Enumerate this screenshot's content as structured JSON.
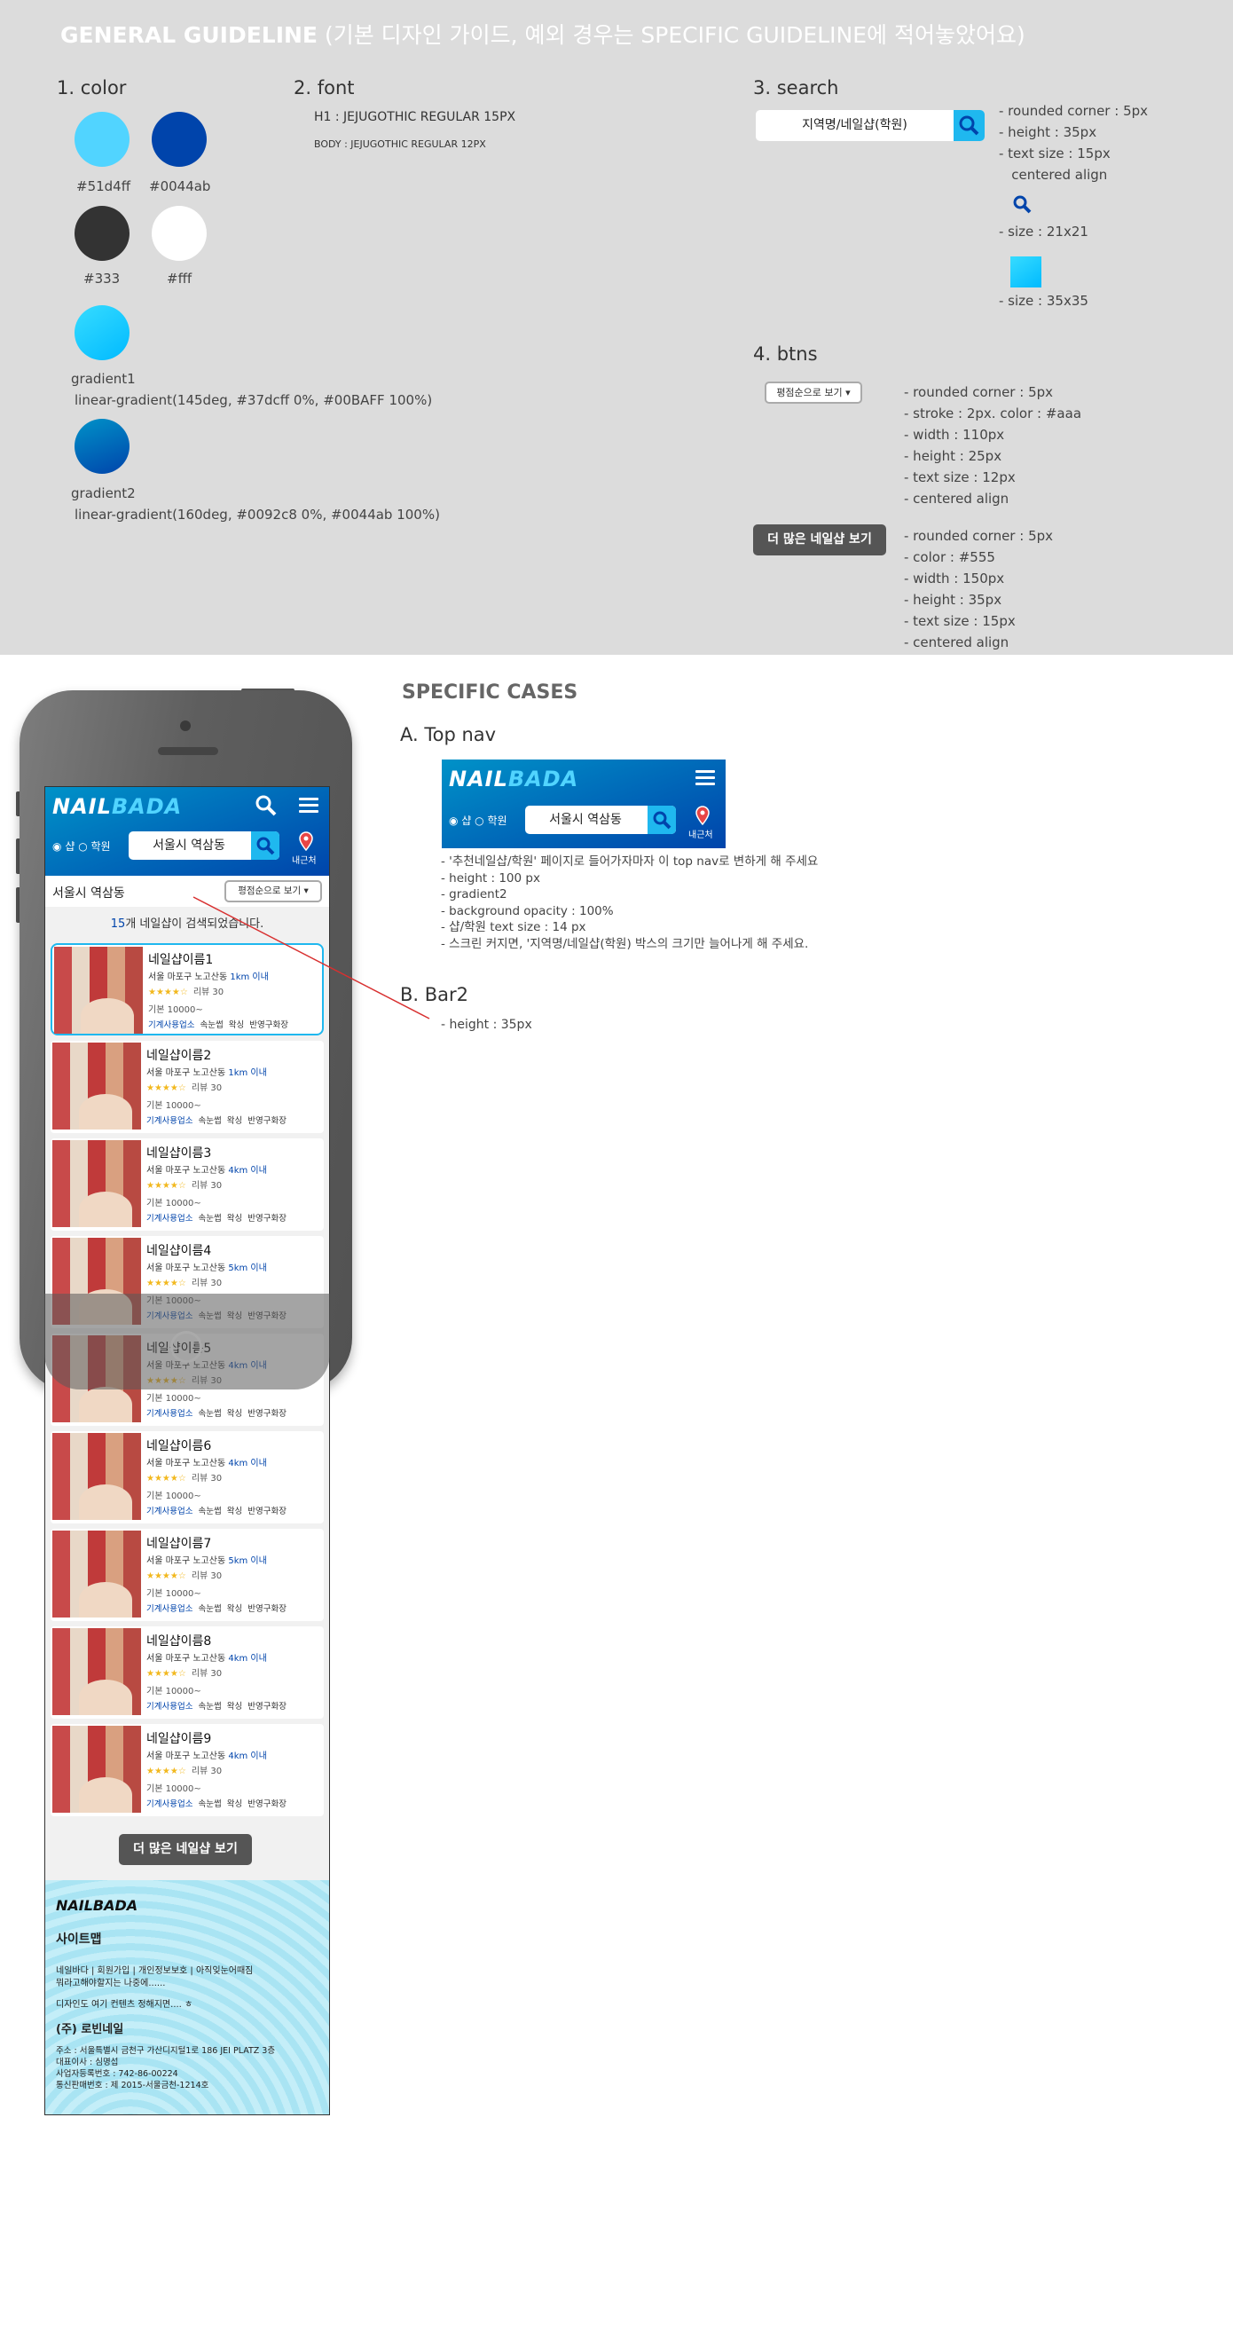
{
  "guide": {
    "title_bold": "GENERAL GUIDELINE",
    "title_rest": " (기본 디자인 가이드, 예외 경우는 SPECIFIC GUIDELINE에 적어놓았어요)",
    "color_h": "1. color",
    "font_h": "2. font",
    "search_h": "3. search",
    "btns_h": "4. btns",
    "colors": [
      {
        "hex": "#51d4ff",
        "label": "#51d4ff"
      },
      {
        "hex": "#0044ab",
        "label": "#0044ab"
      },
      {
        "hex": "#333333",
        "label": "#333"
      },
      {
        "hex": "#ffffff",
        "label": "#fff"
      }
    ],
    "gradient1_label": "gradient1",
    "gradient1_css": "linear-gradient(145deg, #37dcff 0%, #00BAFF 100%)",
    "gradient2_label": "gradient2",
    "gradient2_css": "linear-gradient(160deg, #0092c8 0%, #0044ab 100%)",
    "font_h1": "H1 : JEJUGOTHIC REGULAR 15PX",
    "font_body": "BODY : JEJUGOTHIC REGULAR 12PX",
    "search_text": "지역명/네일샵(학원)",
    "search_notes": [
      "- rounded corner : 5px",
      "- height : 35px",
      "- text size : 15px",
      "   centered align"
    ],
    "icon_size": "- size : 21x21",
    "box_size": "- size : 35x35",
    "btn1_label": "평점순으로 보기 ▾",
    "btn1_notes": [
      "- rounded corner : 5px",
      "- stroke : 2px. color : #aaa",
      "- width : 110px",
      "- height : 25px",
      "- text size : 12px",
      "- centered align"
    ],
    "btn2_label": "더 많은 네일샵 보기",
    "btn2_notes": [
      "- rounded corner : 5px",
      "- color : #555",
      "- width : 150px",
      "- height : 35px",
      "- text size : 15px",
      "- centered align"
    ]
  },
  "spec": {
    "title": "SPECIFIC CASES",
    "a_h": "A. Top nav",
    "b_h": "B. Bar2",
    "a_notes": [
      "- '추천네일샵/학원' 페이지로 들어가자마자 이 top nav로 변하게 해 주세요",
      "- height : 100 px",
      "- gradient2",
      "- background opacity : 100%",
      "- 샵/학원 text size : 14 px",
      "- 스크린 커지면, '지역명/네일샵(학원) 박스의 크기만 늘어나게 해 주세요."
    ],
    "b_notes": [
      "- height : 35px"
    ]
  },
  "app": {
    "logo_a": "NAIL",
    "logo_b": "BADA",
    "radio_shop": "샵",
    "radio_academy": "학원",
    "search_value": "서울시 역삼동",
    "nearby": "내근처",
    "location": "서울시 역삼동",
    "sort_label": "평점순으로 보기 ▾",
    "count_num": "15",
    "count_text": "개 네일샵이 검색되었습니다.",
    "shops": [
      {
        "name": "네일샵이름1",
        "addr": "서울 마포구 노고산동",
        "dist": "1km 이내",
        "stars": "★★★★☆",
        "reviews": "리뷰 30",
        "price": "기본 10000~",
        "tag1": "기계사용업소",
        "tags": "속눈썹  왁싱  반영구화장"
      },
      {
        "name": "네일샵이름2",
        "addr": "서울 마포구 노고산동",
        "dist": "1km 이내",
        "stars": "★★★★☆",
        "reviews": "리뷰 30",
        "price": "기본 10000~",
        "tag1": "기계사용업소",
        "tags": "속눈썹  왁싱  반영구화장"
      },
      {
        "name": "네일샵이름3",
        "addr": "서울 마포구 노고산동",
        "dist": "4km 이내",
        "stars": "★★★★☆",
        "reviews": "리뷰 30",
        "price": "기본 10000~",
        "tag1": "기계사용업소",
        "tags": "속눈썹  왁싱  반영구화장"
      },
      {
        "name": "네일샵이름4",
        "addr": "서울 마포구 노고산동",
        "dist": "5km 이내",
        "stars": "★★★★☆",
        "reviews": "리뷰 30",
        "price": "기본 10000~",
        "tag1": "기계사용업소",
        "tags": "속눈썹  왁싱  반영구화장"
      },
      {
        "name": "네일샵이름5",
        "addr": "서울 마포구 노고산동",
        "dist": "4km 이내",
        "stars": "★★★★☆",
        "reviews": "리뷰 30",
        "price": "기본 10000~",
        "tag1": "기계사용업소",
        "tags": "속눈썹  왁싱  반영구화장"
      },
      {
        "name": "네일샵이름6",
        "addr": "서울 마포구 노고산동",
        "dist": "4km 이내",
        "stars": "★★★★☆",
        "reviews": "리뷰 30",
        "price": "기본 10000~",
        "tag1": "기계사용업소",
        "tags": "속눈썹  왁싱  반영구화장"
      },
      {
        "name": "네일샵이름7",
        "addr": "서울 마포구 노고산동",
        "dist": "5km 이내",
        "stars": "★★★★☆",
        "reviews": "리뷰 30",
        "price": "기본 10000~",
        "tag1": "기계사용업소",
        "tags": "속눈썹  왁싱  반영구화장"
      },
      {
        "name": "네일샵이름8",
        "addr": "서울 마포구 노고산동",
        "dist": "4km 이내",
        "stars": "★★★★☆",
        "reviews": "리뷰 30",
        "price": "기본 10000~",
        "tag1": "기계사용업소",
        "tags": "속눈썹  왁싱  반영구화장"
      },
      {
        "name": "네일샵이름9",
        "addr": "서울 마포구 노고산동",
        "dist": "4km 이내",
        "stars": "★★★★☆",
        "reviews": "리뷰 30",
        "price": "기본 10000~",
        "tag1": "기계사용업소",
        "tags": "속눈썹  왁싱  반영구화장"
      }
    ],
    "more_label": "더 많은 네일샵 보기",
    "footer": {
      "logo": "NAILBADA",
      "sitemap": "사이트맵",
      "links": "네일바다   |    회원가입    |    개인정보보호    |    아직잊눈어때짐",
      "links2": "뭐라고해야할지는 나중에......",
      "design": "디자인도 여기 컨텐츠 정해지면.... ㅎ",
      "company": "(주) 로빈네일",
      "addr": "주소 : 서울특별시 금천구 가산디지털1로 186 JEI PLATZ 3층",
      "ceo": "대표이사 : 심명섭",
      "biz": "사업자등록번호 : 742-86-00224",
      "mail": "통신판매번호 : 제 2015-서울금천-1214호"
    }
  }
}
